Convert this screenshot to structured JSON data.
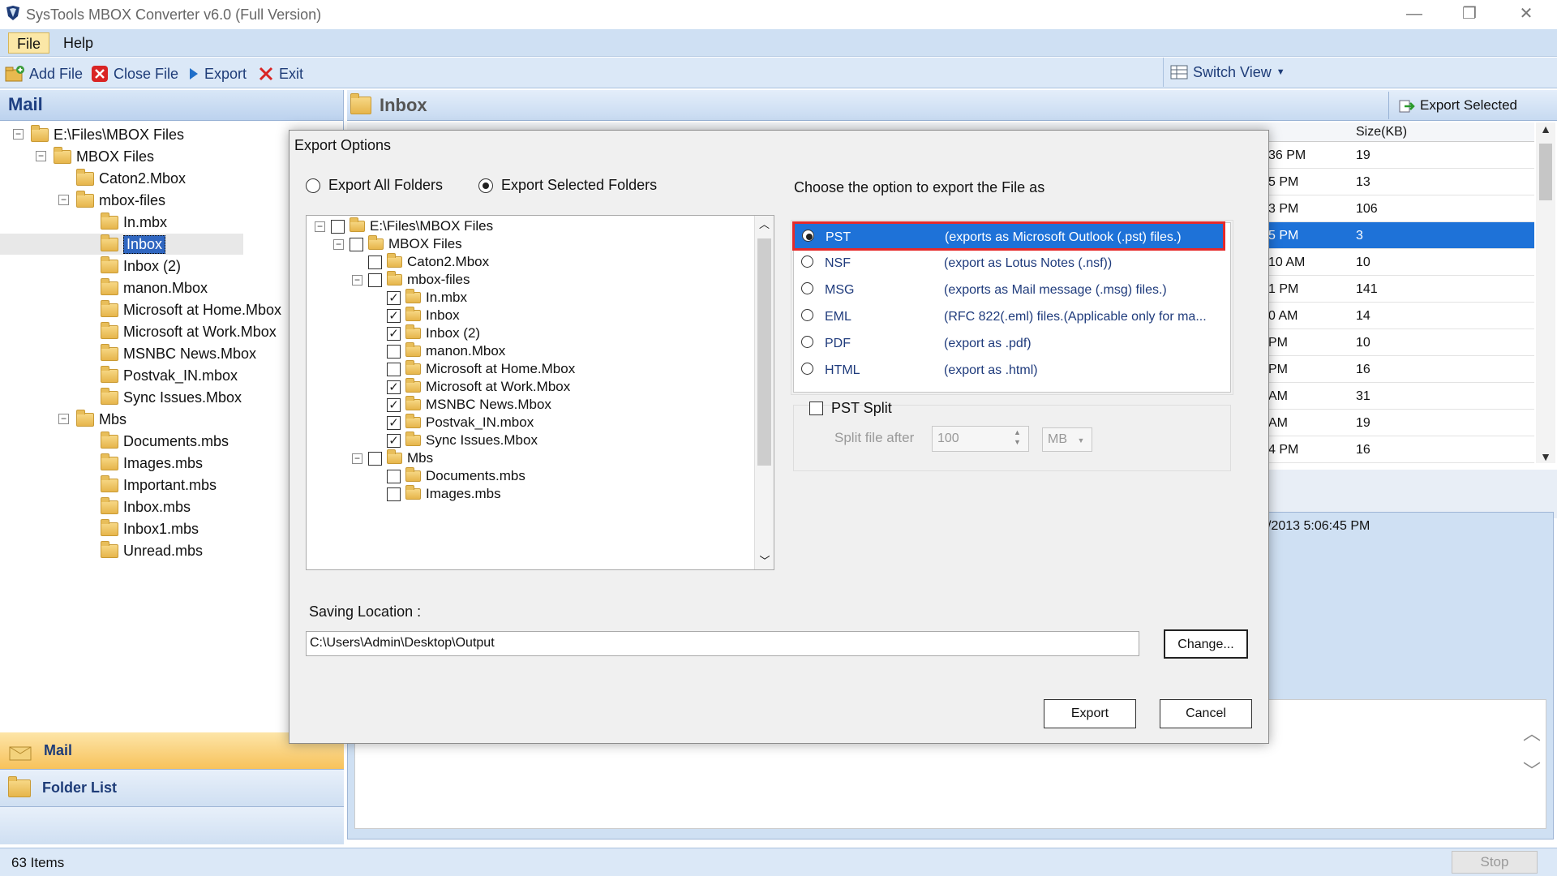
{
  "window": {
    "title": "SysTools MBOX Converter v6.0 (Full Version)"
  },
  "menu": {
    "file": "File",
    "help": "Help"
  },
  "toolbar": {
    "add_file": "Add File",
    "close_file": "Close File",
    "export": "Export",
    "exit": "Exit",
    "switch_view": "Switch View"
  },
  "left": {
    "header": "Mail",
    "tree": [
      {
        "label": "E:\\Files\\MBOX Files"
      },
      {
        "label": "MBOX Files"
      },
      {
        "label": "Caton2.Mbox"
      },
      {
        "label": "mbox-files"
      },
      {
        "label": "In.mbx"
      },
      {
        "label": "Inbox"
      },
      {
        "label": "Inbox (2)"
      },
      {
        "label": "manon.Mbox"
      },
      {
        "label": "Microsoft at Home.Mbox"
      },
      {
        "label": "Microsoft at Work.Mbox"
      },
      {
        "label": "MSNBC News.Mbox"
      },
      {
        "label": "Postvak_IN.mbox"
      },
      {
        "label": "Sync Issues.Mbox"
      },
      {
        "label": "Mbs"
      },
      {
        "label": "Documents.mbs"
      },
      {
        "label": "Images.mbs"
      },
      {
        "label": "Important.mbs"
      },
      {
        "label": "Inbox.mbs"
      },
      {
        "label": "Inbox1.mbs"
      },
      {
        "label": "Unread.mbs"
      }
    ],
    "nav_mail": "Mail",
    "nav_folder_list": "Folder List"
  },
  "inbox": {
    "header": "Inbox",
    "export_selected": "Export Selected",
    "size_col": "Size(KB)",
    "rows": [
      {
        "time": "36 PM",
        "size": "19"
      },
      {
        "time": "5 PM",
        "size": "13"
      },
      {
        "time": "3 PM",
        "size": "106"
      },
      {
        "time": "5 PM",
        "size": "3"
      },
      {
        "time": "10 AM",
        "size": "10"
      },
      {
        "time": "1 PM",
        "size": "141"
      },
      {
        "time": "0 AM",
        "size": "14"
      },
      {
        "time": "PM",
        "size": "10"
      },
      {
        "time": "PM",
        "size": "16"
      },
      {
        "time": "AM",
        "size": "31"
      },
      {
        "time": "AM",
        "size": "19"
      },
      {
        "time": "4 PM",
        "size": "16"
      }
    ],
    "preview_date": "/2013 5:06:45 PM"
  },
  "status": {
    "items": "63 Items",
    "stop": "Stop"
  },
  "dialog": {
    "title": "Export Options",
    "export_all": "Export All Folders",
    "export_selected": "Export Selected Folders",
    "choose_label": "Choose the option to export the File as",
    "tree": [
      {
        "label": "E:\\Files\\MBOX Files",
        "checked": false
      },
      {
        "label": "MBOX Files",
        "checked": false
      },
      {
        "label": "Caton2.Mbox",
        "checked": false
      },
      {
        "label": "mbox-files",
        "checked": false
      },
      {
        "label": "In.mbx",
        "checked": true
      },
      {
        "label": "Inbox",
        "checked": true
      },
      {
        "label": "Inbox (2)",
        "checked": true
      },
      {
        "label": "manon.Mbox",
        "checked": false
      },
      {
        "label": "Microsoft at Home.Mbox",
        "checked": false
      },
      {
        "label": "Microsoft at Work.Mbox",
        "checked": true
      },
      {
        "label": "MSNBC News.Mbox",
        "checked": true
      },
      {
        "label": "Postvak_IN.mbox",
        "checked": true
      },
      {
        "label": "Sync Issues.Mbox",
        "checked": true
      },
      {
        "label": "Mbs",
        "checked": false
      },
      {
        "label": "Documents.mbs",
        "checked": false
      },
      {
        "label": "Images.mbs",
        "checked": false
      }
    ],
    "formats": [
      {
        "name": "PST",
        "desc": "(exports as Microsoft Outlook (.pst) files.)"
      },
      {
        "name": "NSF",
        "desc": "(export as Lotus Notes (.nsf))"
      },
      {
        "name": "MSG",
        "desc": "(exports as Mail message (.msg) files.)"
      },
      {
        "name": "EML",
        "desc": "(RFC 822(.eml) files.(Applicable only for ma..."
      },
      {
        "name": "PDF",
        "desc": "(export as .pdf)"
      },
      {
        "name": "HTML",
        "desc": "(export as .html)"
      }
    ],
    "pst_split": "PST Split",
    "split_after": "Split file after",
    "split_value": "100",
    "split_unit": "MB",
    "saving_label": "Saving Location :",
    "saving_path": "C:\\Users\\Admin\\Desktop\\Output",
    "change": "Change...",
    "export": "Export",
    "cancel": "Cancel"
  },
  "colors": {
    "accent": "#1e72d8",
    "highlight_border": "#e52a2a",
    "menu_bg": "#cfe0f3"
  }
}
